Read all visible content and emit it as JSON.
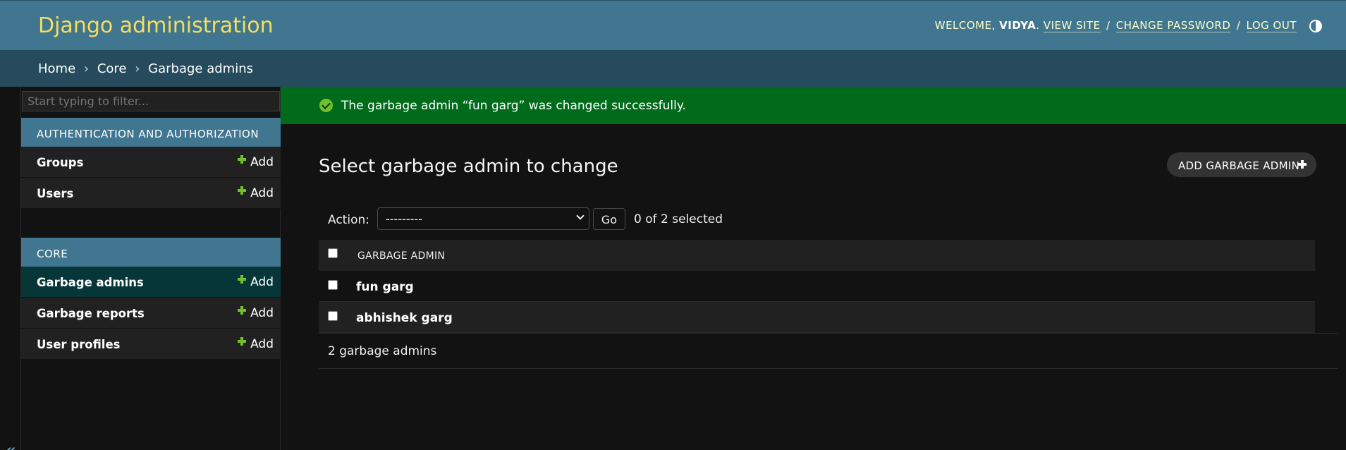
{
  "header": {
    "branding": "Django administration",
    "welcome": "Welcome,",
    "username": "vidya",
    "username_suffix": ".",
    "view_site": "View site",
    "change_password": "Change password",
    "log_out": "Log out",
    "separator": "/"
  },
  "breadcrumbs": {
    "home": "Home",
    "app": "Core",
    "current": "Garbage admins",
    "separator": "›"
  },
  "sidebar": {
    "filter_placeholder": "Start typing to filter...",
    "modules": [
      {
        "caption": "Authentication and Authorization",
        "rows": [
          {
            "label": "Groups",
            "add": "Add"
          },
          {
            "label": "Users",
            "add": "Add"
          }
        ]
      },
      {
        "caption": "Core",
        "rows": [
          {
            "label": "Garbage admins",
            "add": "Add"
          },
          {
            "label": "Garbage reports",
            "add": "Add"
          },
          {
            "label": "User profiles",
            "add": "Add"
          }
        ]
      }
    ],
    "collapse_glyph": "«"
  },
  "message": {
    "text": "The garbage admin “fun garg” was changed successfully."
  },
  "content": {
    "title": "Select garbage admin to change",
    "add_button": "Add garbage admin",
    "action_label": "Action:",
    "action_selected": "---------",
    "go_button": "Go",
    "counter": "0 of 2 selected",
    "column_header": "Garbage admin",
    "rows": [
      "fun garg",
      "abhishek garg"
    ],
    "paginator": "2 garbage admins"
  },
  "colors": {
    "header": "#417690",
    "breadcrumbs": "#264b5d",
    "branding": "#f5dd5d",
    "success": "#006b1b",
    "add_green": "#70bf2b"
  }
}
